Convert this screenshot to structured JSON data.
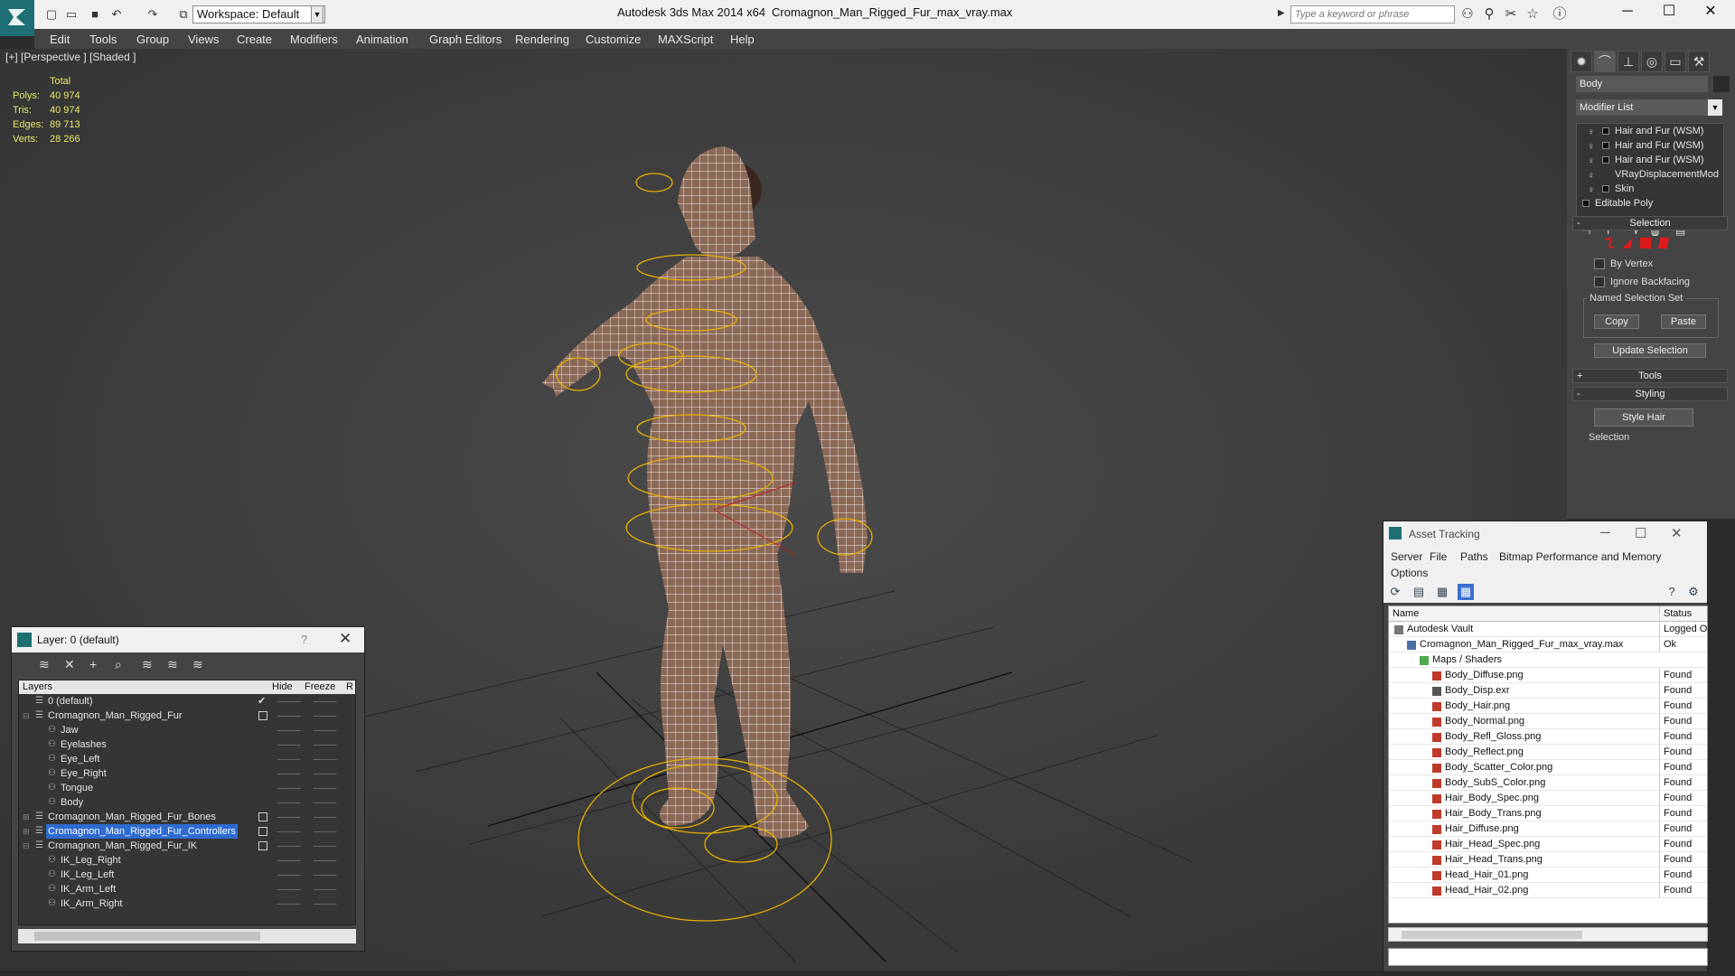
{
  "titlebar": {
    "workspace_label": "Workspace: Default",
    "app_title": "Autodesk 3ds Max  2014 x64",
    "file_title": "Cromagnon_Man_Rigged_Fur_max_vray.max",
    "search_placeholder": "Type a keyword or phrase"
  },
  "menu": [
    "Edit",
    "Tools",
    "Group",
    "Views",
    "Create",
    "Modifiers",
    "Animation",
    "Graph Editors",
    "Rendering",
    "Customize",
    "MAXScript",
    "Help"
  ],
  "viewport": {
    "label": "[+] [Perspective ] [Shaded ]",
    "stats_header": "Total",
    "stats": [
      {
        "k": "Polys:",
        "v": "40 974"
      },
      {
        "k": "Tris:",
        "v": "40 974"
      },
      {
        "k": "Edges:",
        "v": "89 713"
      },
      {
        "k": "Verts:",
        "v": "28 266"
      }
    ]
  },
  "command_panel": {
    "object_name": "Body",
    "modifier_list": "Modifier List",
    "stack": [
      {
        "label": "Hair and Fur (WSM)",
        "has_box": true
      },
      {
        "label": "Hair and Fur (WSM)",
        "has_box": true
      },
      {
        "label": "Hair and Fur (WSM)",
        "has_box": true
      },
      {
        "label": "VRayDisplacementMod",
        "has_box": false
      },
      {
        "label": "Skin",
        "has_box": true
      },
      {
        "label": "Editable Poly",
        "plain": true
      }
    ],
    "selection_title": "Selection",
    "by_vertex": "By Vertex",
    "ignore_backfacing": "Ignore Backfacing",
    "named_selection_set": "Named Selection Set",
    "copy": "Copy",
    "paste": "Paste",
    "update_selection": "Update Selection",
    "tools_title": "Tools",
    "styling_title": "Styling",
    "style_hair": "Style Hair",
    "selection_sub": "Selection",
    "plus": "+",
    "minus": "-",
    "colors": {
      "red_icon": "#e0191b",
      "accent": "#2d6bd1"
    }
  },
  "layer_explorer": {
    "title": "Layer: 0 (default)",
    "help": "?",
    "columns": {
      "layers": "Layers",
      "hide": "Hide",
      "freeze": "Freeze",
      "r": "R"
    },
    "rows": [
      {
        "name": "0 (default)",
        "level": 0,
        "type": "layer",
        "checked": true
      },
      {
        "name": "Cromagnon_Man_Rigged_Fur",
        "level": 0,
        "type": "layer",
        "expand": "-",
        "box": true
      },
      {
        "name": "Jaw",
        "level": 1,
        "type": "obj"
      },
      {
        "name": "Eyelashes",
        "level": 1,
        "type": "obj"
      },
      {
        "name": "Eye_Left",
        "level": 1,
        "type": "obj"
      },
      {
        "name": "Eye_Right",
        "level": 1,
        "type": "obj"
      },
      {
        "name": "Tongue",
        "level": 1,
        "type": "obj"
      },
      {
        "name": "Body",
        "level": 1,
        "type": "obj"
      },
      {
        "name": "Cromagnon_Man_Rigged_Fur_Bones",
        "level": 0,
        "type": "layer",
        "expand": "+",
        "box": true
      },
      {
        "name": "Cromagnon_Man_Rigged_Fur_Controllers",
        "level": 0,
        "type": "layer",
        "expand": "+",
        "box": true,
        "selected": true
      },
      {
        "name": "Cromagnon_Man_Rigged_Fur_IK",
        "level": 0,
        "type": "layer",
        "expand": "-",
        "box": true
      },
      {
        "name": "IK_Leg_Right",
        "level": 1,
        "type": "obj"
      },
      {
        "name": "IK_Leg_Left",
        "level": 1,
        "type": "obj"
      },
      {
        "name": "IK_Arm_Left",
        "level": 1,
        "type": "obj"
      },
      {
        "name": "IK_Arm_Right",
        "level": 1,
        "type": "obj"
      }
    ]
  },
  "asset_tracking": {
    "title": "Asset Tracking",
    "menu": [
      "Server",
      "File",
      "Paths",
      "Bitmap Performance and Memory",
      "Options"
    ],
    "columns": {
      "name": "Name",
      "status": "Status"
    },
    "rows": [
      {
        "name": "Autodesk Vault",
        "status": "Logged O",
        "level": 0,
        "icon": "vault"
      },
      {
        "name": "Cromagnon_Man_Rigged_Fur_max_vray.max",
        "status": "Ok",
        "level": 1,
        "icon": "file"
      },
      {
        "name": "Maps / Shaders",
        "status": "",
        "level": 2,
        "icon": "maps"
      },
      {
        "name": "Body_Diffuse.png",
        "status": "Found",
        "level": 3,
        "icon": "png"
      },
      {
        "name": "Body_Disp.exr",
        "status": "Found",
        "level": 3,
        "icon": "exr"
      },
      {
        "name": "Body_Hair.png",
        "status": "Found",
        "level": 3,
        "icon": "png"
      },
      {
        "name": "Body_Normal.png",
        "status": "Found",
        "level": 3,
        "icon": "png"
      },
      {
        "name": "Body_Refl_Gloss.png",
        "status": "Found",
        "level": 3,
        "icon": "png"
      },
      {
        "name": "Body_Reflect.png",
        "status": "Found",
        "level": 3,
        "icon": "png"
      },
      {
        "name": "Body_Scatter_Color.png",
        "status": "Found",
        "level": 3,
        "icon": "png"
      },
      {
        "name": "Body_SubS_Color.png",
        "status": "Found",
        "level": 3,
        "icon": "png"
      },
      {
        "name": "Hair_Body_Spec.png",
        "status": "Found",
        "level": 3,
        "icon": "png"
      },
      {
        "name": "Hair_Body_Trans.png",
        "status": "Found",
        "level": 3,
        "icon": "png"
      },
      {
        "name": "Hair_Diffuse.png",
        "status": "Found",
        "level": 3,
        "icon": "png"
      },
      {
        "name": "Hair_Head_Spec.png",
        "status": "Found",
        "level": 3,
        "icon": "png"
      },
      {
        "name": "Hair_Head_Trans.png",
        "status": "Found",
        "level": 3,
        "icon": "png"
      },
      {
        "name": "Head_Hair_01.png",
        "status": "Found",
        "level": 3,
        "icon": "png"
      },
      {
        "name": "Head_Hair_02.png",
        "status": "Found",
        "level": 3,
        "icon": "png"
      }
    ]
  }
}
